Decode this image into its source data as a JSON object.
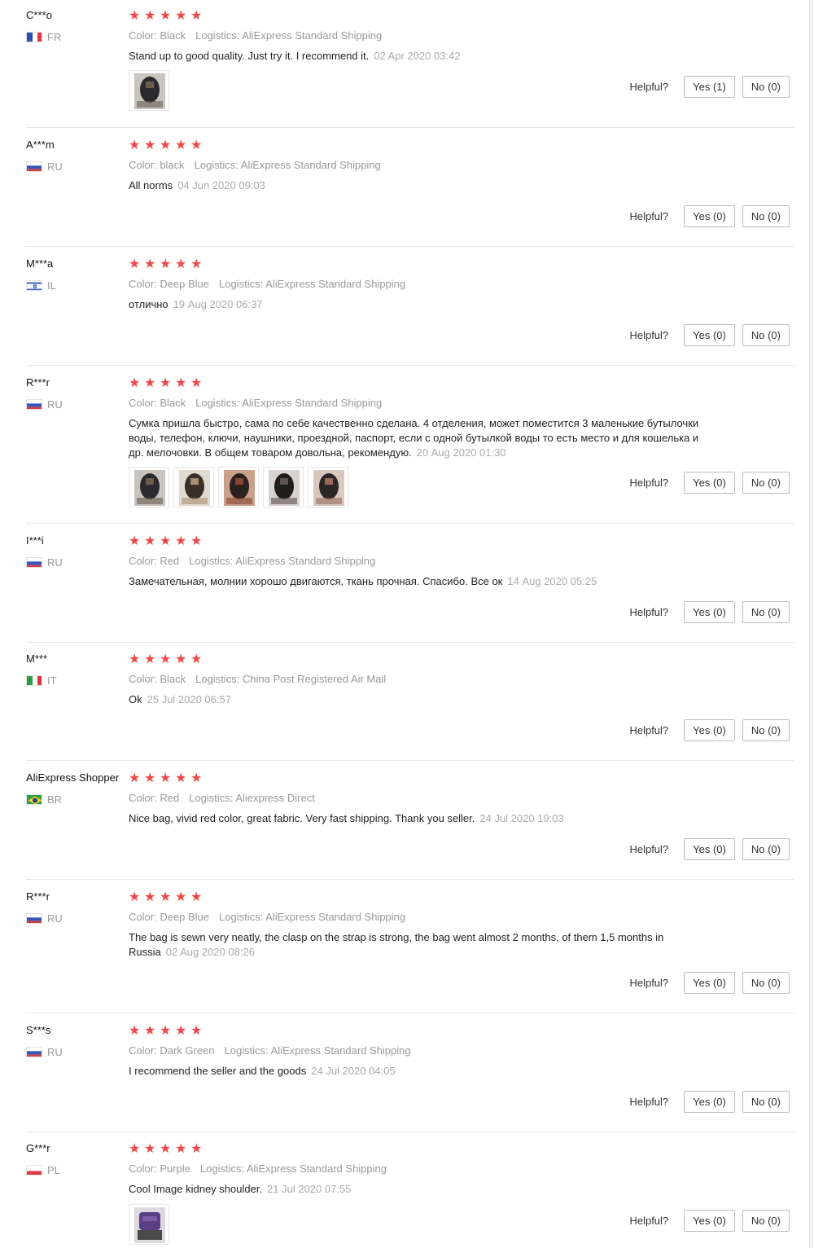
{
  "labels": {
    "color": "Color:",
    "logistics": "Logistics:",
    "helpful": "Helpful?"
  },
  "colors": {
    "star": "#f04848",
    "divider": "#e8e8e8",
    "meta": "#999999"
  },
  "reviews": [
    {
      "user": "C***o",
      "country": "FR",
      "flag": "fr",
      "rating": 5,
      "color": "Black",
      "logistics": "AliExpress Standard Shipping",
      "text": "Stand up to good quality. Just try it. I recommend it.",
      "date": "02 Apr 2020 03:42",
      "yes": "Yes (1)",
      "no": "No (0)",
      "photos": [
        "bag-photo"
      ]
    },
    {
      "user": "A***m",
      "country": "RU",
      "flag": "ru",
      "rating": 5,
      "color": "black",
      "logistics": "AliExpress Standard Shipping",
      "text": "All norms",
      "date": "04 Jun 2020 09:03",
      "yes": "Yes (0)",
      "no": "No (0)",
      "photos": []
    },
    {
      "user": "M***a",
      "country": "IL",
      "flag": "il",
      "rating": 5,
      "color": "Deep Blue",
      "logistics": "AliExpress Standard Shipping",
      "text": "отлично",
      "date": "19 Aug 2020 06:37",
      "yes": "Yes (0)",
      "no": "No (0)",
      "photos": []
    },
    {
      "user": "R***r",
      "country": "RU",
      "flag": "ru",
      "rating": 5,
      "color": "Black",
      "logistics": "AliExpress Standard Shipping",
      "text": "Сумка пришла быстро, сама по себе качественно сделана. 4 отделения, может поместится 3 маленькие бутылочки воды, телефон, ключи, наушники, проездной, паспорт, если с одной бутылкой воды то есть место и для кошелька и др. мелочовки. В общем товаром довольна, рекомендую.",
      "date": "20 Aug 2020 01:30",
      "yes": "Yes (0)",
      "no": "No (0)",
      "photos": [
        "bag-photo",
        "bag-photo",
        "bag-photo",
        "bag-photo",
        "bag-photo"
      ]
    },
    {
      "user": "I***i",
      "country": "RU",
      "flag": "ru",
      "rating": 5,
      "color": "Red",
      "logistics": "AliExpress Standard Shipping",
      "text": "Замечательная, молнии хорошо двигаются, ткань прочная. Спасибо. Все ок",
      "date": "14 Aug 2020 05:25",
      "yes": "Yes (0)",
      "no": "No (0)",
      "photos": []
    },
    {
      "user": "M***",
      "country": "IT",
      "flag": "it",
      "rating": 5,
      "color": "Black",
      "logistics": "China Post Registered Air Mail",
      "text": "Ok",
      "date": "25 Jul 2020 06:57",
      "yes": "Yes (0)",
      "no": "No (0)",
      "photos": []
    },
    {
      "user": "AliExpress Shopper",
      "country": "BR",
      "flag": "br",
      "rating": 5,
      "color": "Red",
      "logistics": "Aliexpress Direct",
      "text": "Nice bag, vivid red color, great fabric. Very fast shipping. Thank you seller.",
      "date": "24 Jul 2020 19:03",
      "yes": "Yes (0)",
      "no": "No (0)",
      "photos": []
    },
    {
      "user": "R***r",
      "country": "RU",
      "flag": "ru",
      "rating": 5,
      "color": "Deep Blue",
      "logistics": "AliExpress Standard Shipping",
      "text": "The bag is sewn very neatly, the clasp on the strap is strong, the bag went almost 2 months, of them 1,5 months in Russia",
      "date": "02 Aug 2020 08:26",
      "yes": "Yes (0)",
      "no": "No (0)",
      "photos": []
    },
    {
      "user": "S***s",
      "country": "RU",
      "flag": "ru",
      "rating": 5,
      "color": "Dark Green",
      "logistics": "AliExpress Standard Shipping",
      "text": "I recommend the seller and the goods",
      "date": "24 Jul 2020 04:05",
      "yes": "Yes (0)",
      "no": "No (0)",
      "photos": []
    },
    {
      "user": "G***r",
      "country": "PL",
      "flag": "pl",
      "rating": 5,
      "color": "Purple",
      "logistics": "AliExpress Standard Shipping",
      "text": "Cool Image kidney shoulder.",
      "date": "21 Jul 2020 07:55",
      "yes": "Yes (0)",
      "no": "No (0)",
      "photos": [
        "bag-photo-purple"
      ]
    }
  ]
}
